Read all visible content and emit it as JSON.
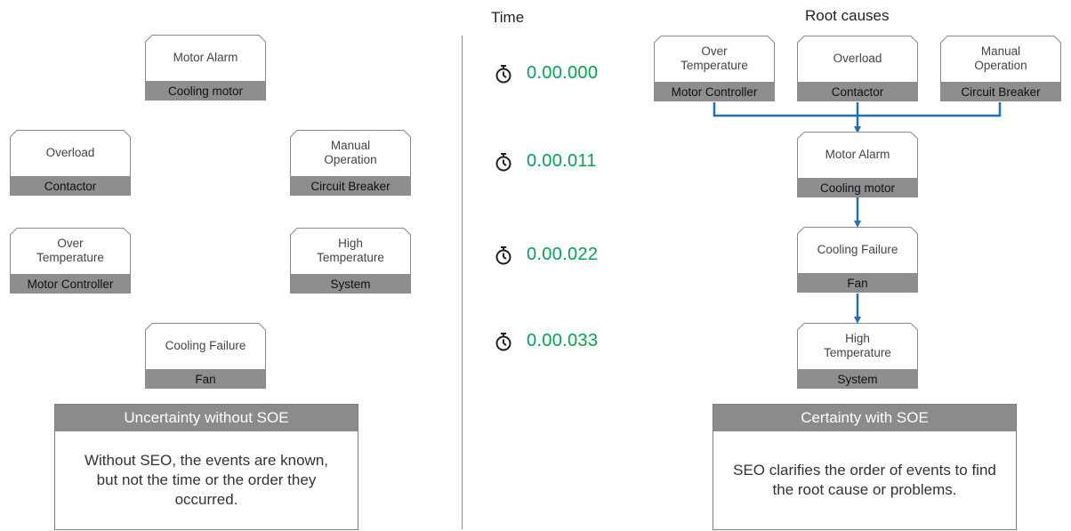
{
  "left": {
    "nodes": [
      {
        "title": "Motor Alarm",
        "label": "Cooling motor"
      },
      {
        "title": "Overload",
        "label": "Contactor"
      },
      {
        "title": "Manual\nOperation",
        "label": "Circuit Breaker"
      },
      {
        "title": "Over\nTemperature",
        "label": "Motor Controller"
      },
      {
        "title": "High\nTemperature",
        "label": "System"
      },
      {
        "title": "Cooling Failure",
        "label": "Fan"
      }
    ],
    "panel": {
      "header": "Uncertainty without SOE",
      "body": "Without SEO, the events are known, but not the time or the order they occurred."
    }
  },
  "time": {
    "heading": "Time",
    "values": [
      "0.00.000",
      "0.00.011",
      "0.00.022",
      "0.00.033"
    ],
    "icon": "stopwatch-icon",
    "value_color": "#00a651"
  },
  "right": {
    "heading": "Root causes",
    "roots": [
      {
        "title": "Over\nTemperature",
        "label": "Motor Controller"
      },
      {
        "title": "Overload",
        "label": "Contactor"
      },
      {
        "title": "Manual\nOperation",
        "label": "Circuit Breaker"
      }
    ],
    "chain": [
      {
        "title": "Motor Alarm",
        "label": "Cooling motor"
      },
      {
        "title": "Cooling Failure",
        "label": "Fan"
      },
      {
        "title": "High\nTemperature",
        "label": "System"
      }
    ],
    "arrow_color": "#1f6fbf",
    "panel": {
      "header": "Certainty with SOE",
      "body": "SEO clarifies the order of events to find the root cause or problems."
    }
  }
}
